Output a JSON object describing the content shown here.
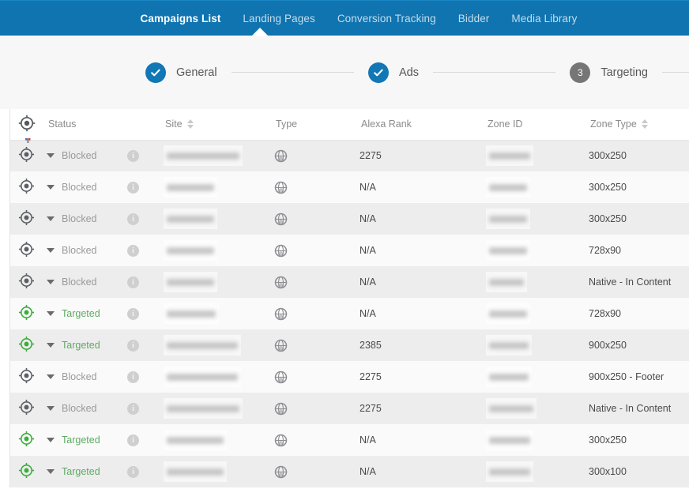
{
  "colors": {
    "nav_blue": "#0f74b0",
    "step_done": "#1177b5",
    "step_pending": "#767676",
    "targeted_green": "#5faa63",
    "blocked_gray": "#9a9a9a",
    "row_odd": "#ededed",
    "row_even": "#fafafa"
  },
  "topnav": {
    "tabs": [
      {
        "label": "Campaigns List",
        "active": true
      },
      {
        "label": "Landing Pages",
        "active": false
      },
      {
        "label": "Conversion Tracking",
        "active": false
      },
      {
        "label": "Bidder",
        "active": false
      },
      {
        "label": "Media Library",
        "active": false
      }
    ]
  },
  "stepper": {
    "steps": [
      {
        "label": "General",
        "state": "done",
        "marker": "check-icon"
      },
      {
        "label": "Ads",
        "state": "done",
        "marker": "check-icon"
      },
      {
        "label": "Targeting",
        "state": "pending",
        "marker": "3"
      }
    ]
  },
  "table": {
    "target_header_icon": "crosshair-icon",
    "columns": [
      {
        "key": "target",
        "label": "",
        "sortable": false
      },
      {
        "key": "status",
        "label": "Status",
        "sortable": false
      },
      {
        "key": "site",
        "label": "Site",
        "sortable": true
      },
      {
        "key": "type",
        "label": "Type",
        "sortable": false
      },
      {
        "key": "alexa",
        "label": "Alexa Rank",
        "sortable": false
      },
      {
        "key": "zone_id",
        "label": "Zone ID",
        "sortable": false
      },
      {
        "key": "zone_type",
        "label": "Zone Type",
        "sortable": true
      }
    ],
    "rows": [
      {
        "status": "Blocked",
        "state": "blocked",
        "site_redacted_width": 92,
        "type_icon": "globe-icon",
        "alexa": "2275",
        "zone_id_redacted_width": 52,
        "zone_type": "300x250"
      },
      {
        "status": "Blocked",
        "state": "blocked",
        "site_redacted_width": 60,
        "type_icon": "globe-icon",
        "alexa": "N/A",
        "zone_id_redacted_width": 48,
        "zone_type": "300x250"
      },
      {
        "status": "Blocked",
        "state": "blocked",
        "site_redacted_width": 60,
        "type_icon": "globe-icon",
        "alexa": "N/A",
        "zone_id_redacted_width": 48,
        "zone_type": "300x250"
      },
      {
        "status": "Blocked",
        "state": "blocked",
        "site_redacted_width": 60,
        "type_icon": "globe-icon",
        "alexa": "N/A",
        "zone_id_redacted_width": 48,
        "zone_type": "728x90"
      },
      {
        "status": "Blocked",
        "state": "blocked",
        "site_redacted_width": 60,
        "type_icon": "globe-icon",
        "alexa": "N/A",
        "zone_id_redacted_width": 44,
        "zone_type": "Native - In Content"
      },
      {
        "status": "Targeted",
        "state": "targeted",
        "site_redacted_width": 62,
        "type_icon": "globe-icon",
        "alexa": "N/A",
        "zone_id_redacted_width": 48,
        "zone_type": "728x90"
      },
      {
        "status": "Targeted",
        "state": "targeted",
        "site_redacted_width": 90,
        "type_icon": "globe-icon",
        "alexa": "2385",
        "zone_id_redacted_width": 50,
        "zone_type": "900x250"
      },
      {
        "status": "Blocked",
        "state": "blocked",
        "site_redacted_width": 90,
        "type_icon": "globe-icon",
        "alexa": "2275",
        "zone_id_redacted_width": 50,
        "zone_type": "900x250 - Footer"
      },
      {
        "status": "Blocked",
        "state": "blocked",
        "site_redacted_width": 92,
        "type_icon": "globe-icon",
        "alexa": "2275",
        "zone_id_redacted_width": 56,
        "zone_type": "Native - In Content"
      },
      {
        "status": "Targeted",
        "state": "targeted",
        "site_redacted_width": 72,
        "type_icon": "globe-icon",
        "alexa": "N/A",
        "zone_id_redacted_width": 52,
        "zone_type": "300x250"
      },
      {
        "status": "Targeted",
        "state": "targeted",
        "site_redacted_width": 72,
        "type_icon": "globe-icon",
        "alexa": "N/A",
        "zone_id_redacted_width": 52,
        "zone_type": "300x100"
      }
    ],
    "row_info_icon": "info-icon",
    "row_caret_icon": "chevron-down-icon"
  }
}
